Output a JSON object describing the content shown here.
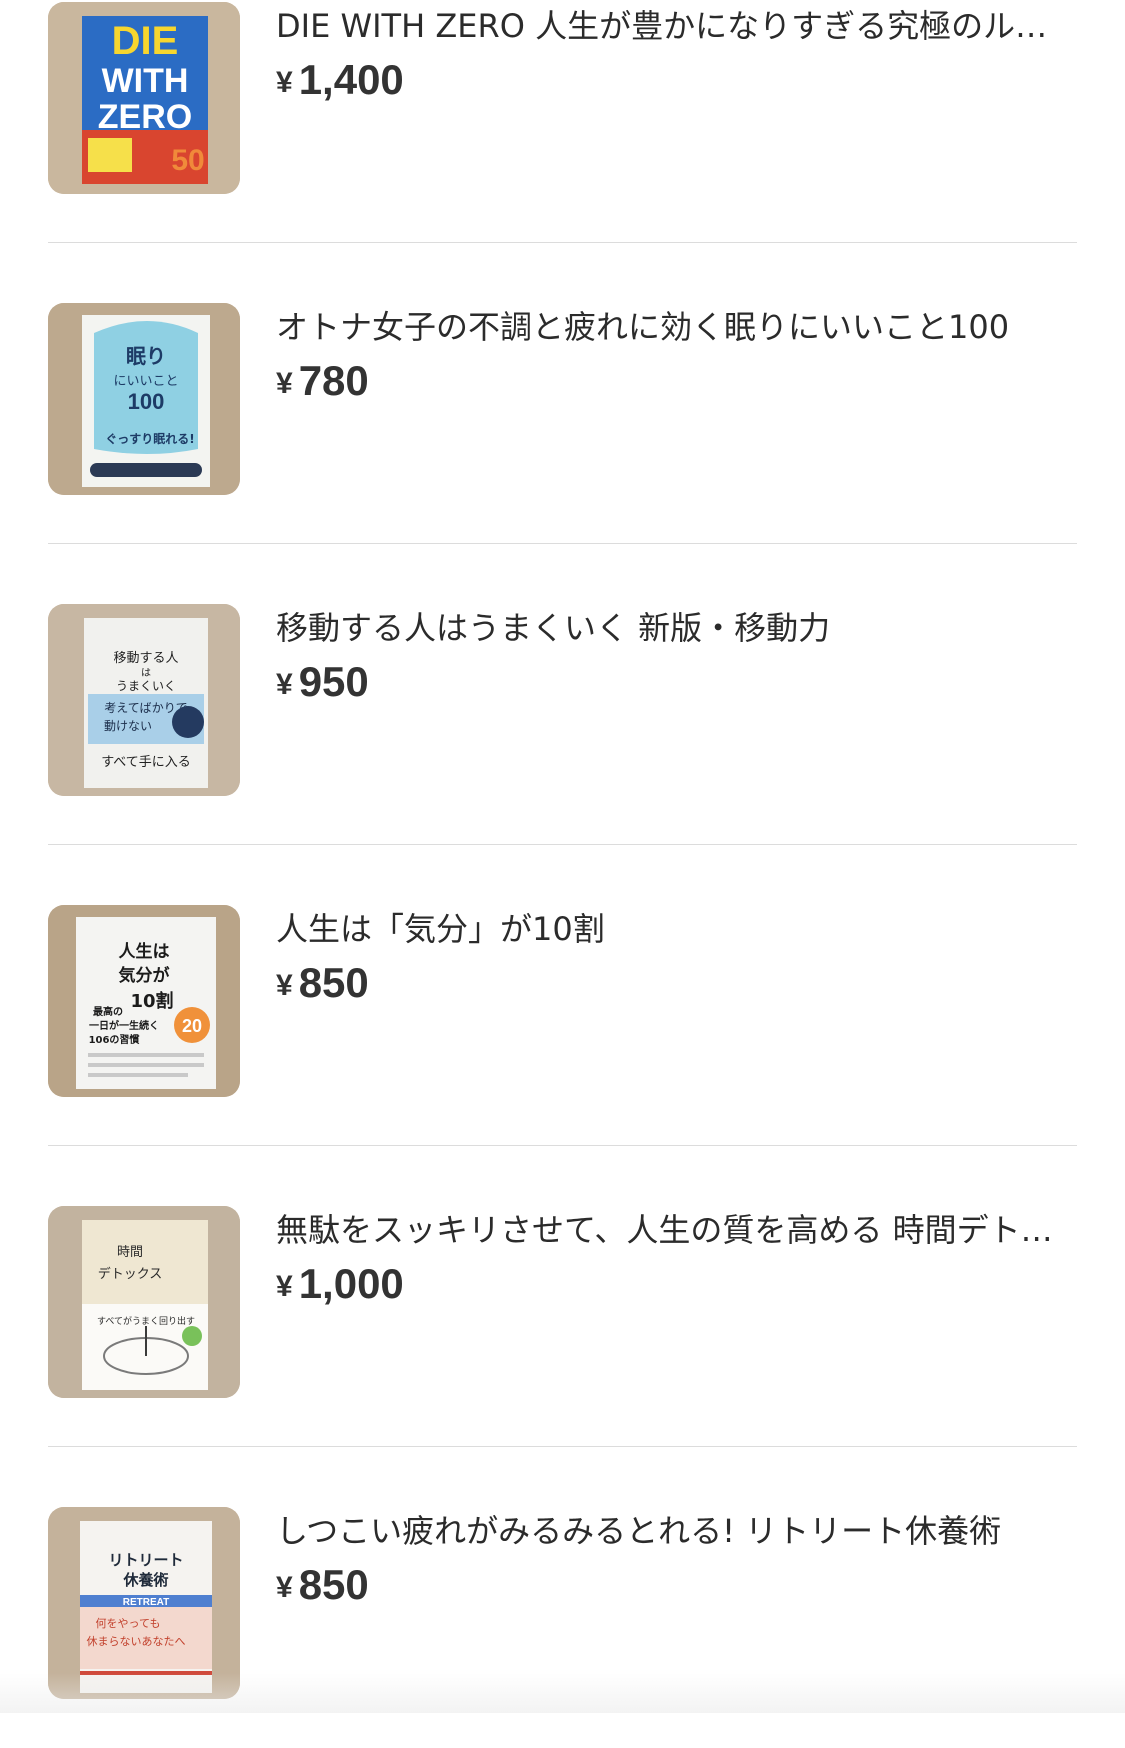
{
  "currency_symbol": "¥",
  "items": [
    {
      "title": "DIE WITH ZERO 人生が豊かになりすぎる究極のルール",
      "price": "1,400",
      "cover_text": [
        "DIE",
        "WITH",
        "ZERO"
      ],
      "cover_color": "#2a6fc9"
    },
    {
      "title": "オトナ女子の不調と疲れに効く眠りにいいこと100",
      "price": "780",
      "cover_text": [
        "眠り",
        "にいいこと",
        "100",
        "ぐっすり眠れる!"
      ],
      "cover_color": "#8fd0e3"
    },
    {
      "title": "移動する人はうまくいく 新版・移動力",
      "price": "950",
      "cover_text": [
        "移動する人",
        "は",
        "うまくいく",
        "考えてばかりで",
        "動けない",
        "すべて手に入る"
      ],
      "cover_color": "#f1f1ee"
    },
    {
      "title": "人生は「気分」が10割",
      "price": "850",
      "cover_text": [
        "人生は",
        "気分が",
        "10割",
        "最高の",
        "一日が一生続く",
        "106の習慣",
        "20"
      ],
      "cover_color": "#f4f4f2"
    },
    {
      "title": "無駄をスッキリさせて、人生の質を高める 時間デトックス",
      "price": "1,000",
      "cover_text": [
        "時間",
        "デトックス",
        "すべてがうまく回り出す"
      ],
      "cover_color": "#efe7d2"
    },
    {
      "title": "しつこい疲れがみるみるとれる! リトリート休養術",
      "price": "850",
      "cover_text": [
        "リトリート",
        "休養術",
        "RETREAT",
        "何をやっても",
        "休まらないあなたへ"
      ],
      "cover_color": "#f5f3f0"
    }
  ]
}
